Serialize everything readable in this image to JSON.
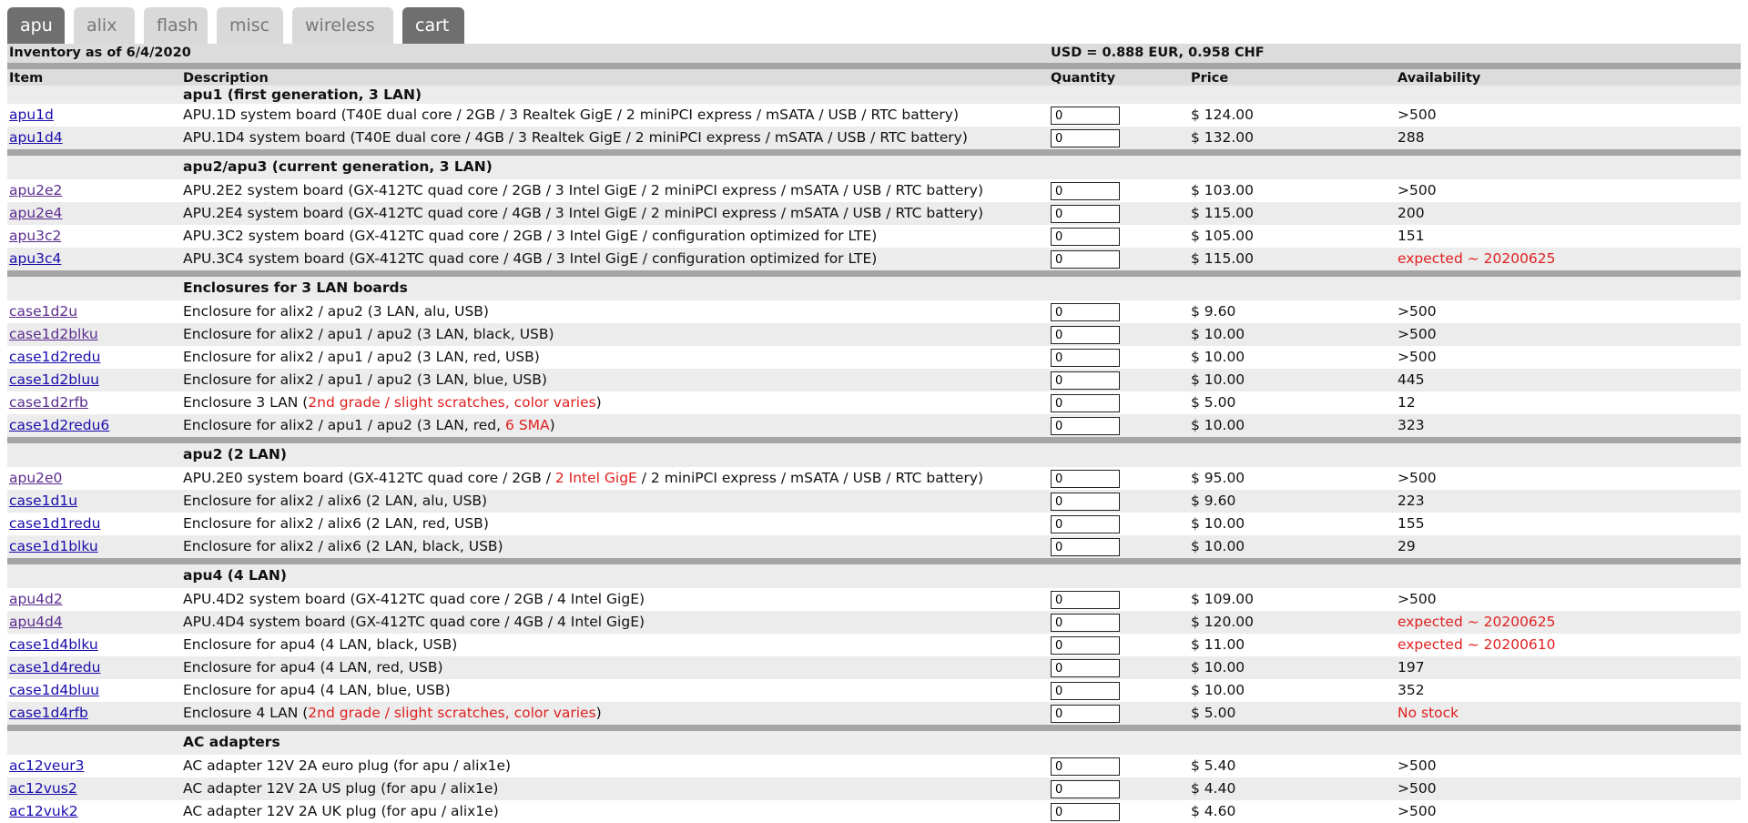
{
  "tabs": [
    "apu",
    "alix",
    "flash",
    "misc",
    "wireless",
    "cart"
  ],
  "inventory_title": "Inventory as of 6/4/2020",
  "exchange_rate": "USD = 0.888 EUR, 0.958 CHF",
  "columns": {
    "item": "Item",
    "description": "Description",
    "quantity": "Quantity",
    "price": "Price",
    "availability": "Availability"
  },
  "sections": {
    "s1": "apu1 (first generation, 3 LAN)",
    "s2": "apu2/apu3 (current generation, 3 LAN)",
    "s3": "Enclosures for 3 LAN boards",
    "s4": "apu2 (2 LAN)",
    "s5": "apu4 (4 LAN)",
    "s6": "AC adapters"
  },
  "products": {
    "apu1d": {
      "item": "apu1d",
      "desc": "APU.1D system board (T40E dual core / 2GB / 3 Realtek GigE / 2 miniPCI express / mSATA / USB / RTC battery)",
      "qty": "0",
      "price": "$ 124.00",
      "avail": ">500"
    },
    "apu1d4": {
      "item": "apu1d4",
      "desc": "APU.1D4 system board (T40E dual core / 4GB / 3 Realtek GigE / 2 miniPCI express / mSATA / USB / RTC battery)",
      "qty": "0",
      "price": "$ 132.00",
      "avail": "288"
    },
    "apu2e2": {
      "item": "apu2e2",
      "desc": "APU.2E2 system board (GX-412TC quad core / 2GB / 3 Intel GigE / 2 miniPCI express / mSATA / USB / RTC battery)",
      "qty": "0",
      "price": "$ 103.00",
      "avail": ">500"
    },
    "apu2e4": {
      "item": "apu2e4",
      "desc": "APU.2E4 system board (GX-412TC quad core / 4GB / 3 Intel GigE / 2 miniPCI express / mSATA / USB / RTC battery)",
      "qty": "0",
      "price": "$ 115.00",
      "avail": "200"
    },
    "apu3c2": {
      "item": "apu3c2",
      "desc": "APU.3C2 system board (GX-412TC quad core / 2GB / 3 Intel GigE / configuration optimized for LTE)",
      "qty": "0",
      "price": "$ 105.00",
      "avail": "151"
    },
    "apu3c4": {
      "item": "apu3c4",
      "desc": "APU.3C4 system board (GX-412TC quad core / 4GB / 3 Intel GigE / configuration optimized for LTE)",
      "qty": "0",
      "price": "$ 115.00",
      "avail": "expected ~ 20200625"
    },
    "case1d2u": {
      "item": "case1d2u",
      "desc": "Enclosure for alix2 / apu2 (3 LAN, alu, USB)",
      "qty": "0",
      "price": "$ 9.60",
      "avail": ">500"
    },
    "case1d2blku": {
      "item": "case1d2blku",
      "desc": "Enclosure for alix2 / apu1 / apu2 (3 LAN, black, USB)",
      "qty": "0",
      "price": "$ 10.00",
      "avail": ">500"
    },
    "case1d2redu": {
      "item": "case1d2redu",
      "desc": "Enclosure for alix2 / apu1 / apu2 (3 LAN, red, USB)",
      "qty": "0",
      "price": "$ 10.00",
      "avail": ">500"
    },
    "case1d2bluu": {
      "item": "case1d2bluu",
      "desc": "Enclosure for alix2 / apu1 / apu2 (3 LAN, blue, USB)",
      "qty": "0",
      "price": "$ 10.00",
      "avail": "445"
    },
    "case1d2rfb": {
      "item": "case1d2rfb",
      "desc_pre": "Enclosure 3 LAN (",
      "desc_red": "2nd grade / slight scratches, color varies",
      "desc_post": ")",
      "qty": "0",
      "price": "$ 5.00",
      "avail": "12"
    },
    "case1d2redu6": {
      "item": "case1d2redu6",
      "desc_pre": "Enclosure for alix2 / apu1 / apu2 (3 LAN, red, ",
      "desc_red": "6 SMA",
      "desc_post": ")",
      "qty": "0",
      "price": "$ 10.00",
      "avail": "323"
    },
    "apu2e0": {
      "item": "apu2e0",
      "desc_pre": "APU.2E0 system board (GX-412TC quad core / 2GB / ",
      "desc_red": "2 Intel GigE",
      "desc_post": " / 2 miniPCI express / mSATA / USB / RTC battery)",
      "qty": "0",
      "price": "$ 95.00",
      "avail": ">500"
    },
    "case1d1u": {
      "item": "case1d1u",
      "desc": "Enclosure for alix2 / alix6 (2 LAN, alu, USB)",
      "qty": "0",
      "price": "$ 9.60",
      "avail": "223"
    },
    "case1d1redu": {
      "item": "case1d1redu",
      "desc": "Enclosure for alix2 / alix6 (2 LAN, red, USB)",
      "qty": "0",
      "price": "$ 10.00",
      "avail": "155"
    },
    "case1d1blku": {
      "item": "case1d1blku",
      "desc": "Enclosure for alix2 / alix6 (2 LAN, black, USB)",
      "qty": "0",
      "price": "$ 10.00",
      "avail": "29"
    },
    "apu4d2": {
      "item": "apu4d2",
      "desc": "APU.4D2 system board (GX-412TC quad core / 2GB / 4 Intel GigE)",
      "qty": "0",
      "price": "$ 109.00",
      "avail": ">500"
    },
    "apu4d4": {
      "item": "apu4d4",
      "desc": "APU.4D4 system board (GX-412TC quad core / 4GB / 4 Intel GigE)",
      "qty": "0",
      "price": "$ 120.00",
      "avail": "expected ~ 20200625"
    },
    "case1d4blku": {
      "item": "case1d4blku",
      "desc": "Enclosure for apu4 (4 LAN, black, USB)",
      "qty": "0",
      "price": "$ 11.00",
      "avail": "expected ~ 20200610"
    },
    "case1d4redu": {
      "item": "case1d4redu",
      "desc": "Enclosure for apu4 (4 LAN, red, USB)",
      "qty": "0",
      "price": "$ 10.00",
      "avail": "197"
    },
    "case1d4bluu": {
      "item": "case1d4bluu",
      "desc": "Enclosure for apu4 (4 LAN, blue, USB)",
      "qty": "0",
      "price": "$ 10.00",
      "avail": "352"
    },
    "case1d4rfb": {
      "item": "case1d4rfb",
      "desc_pre": "Enclosure 4 LAN (",
      "desc_red": "2nd grade / slight scratches, color varies",
      "desc_post": ")",
      "qty": "0",
      "price": "$ 5.00",
      "avail": "No stock"
    },
    "ac12veur3": {
      "item": "ac12veur3",
      "desc": "AC adapter 12V 2A euro plug (for apu / alix1e)",
      "qty": "0",
      "price": "$ 5.40",
      "avail": ">500"
    },
    "ac12vus2": {
      "item": "ac12vus2",
      "desc": "AC adapter 12V 2A US plug (for apu / alix1e)",
      "qty": "0",
      "price": "$ 4.40",
      "avail": ">500"
    },
    "ac12vuk2": {
      "item": "ac12vuk2",
      "desc": "AC adapter 12V 2A UK plug (for apu / alix1e)",
      "qty": "0",
      "price": "$ 4.60",
      "avail": ">500"
    }
  },
  "colors": {
    "link": "#1a0dab",
    "visited_link": "#5b2d8f",
    "alert_red": "#e02020",
    "tab_active": "#6f6f6f",
    "tab_inactive": "#d9d9d9"
  }
}
